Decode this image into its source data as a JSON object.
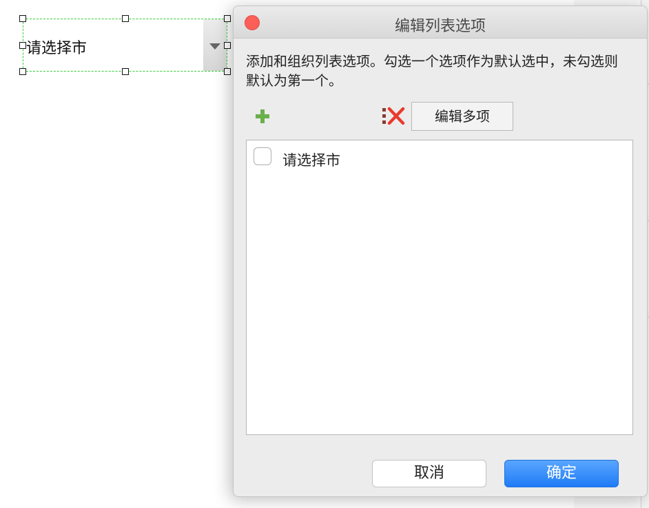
{
  "canvas_widget": {
    "text": "请选择市"
  },
  "dialog": {
    "title": "编辑列表选项",
    "description": "添加和组织列表选项。勾选一个选项作为默认选中，未勾选则默认为第一个。",
    "toolbar": {
      "add_icon": "plus-icon",
      "delete_icon": "delete-x-icon",
      "edit_multiple_label": "编辑多项"
    },
    "items": [
      {
        "label": "请选择市",
        "checked": false
      }
    ],
    "buttons": {
      "cancel": "取消",
      "ok": "确定"
    }
  },
  "colors": {
    "accent": "#1f7bf6",
    "selection": "#33cc33",
    "close": "#fc5f57",
    "add": "#6ab04c",
    "delete": "#e83a2e"
  }
}
